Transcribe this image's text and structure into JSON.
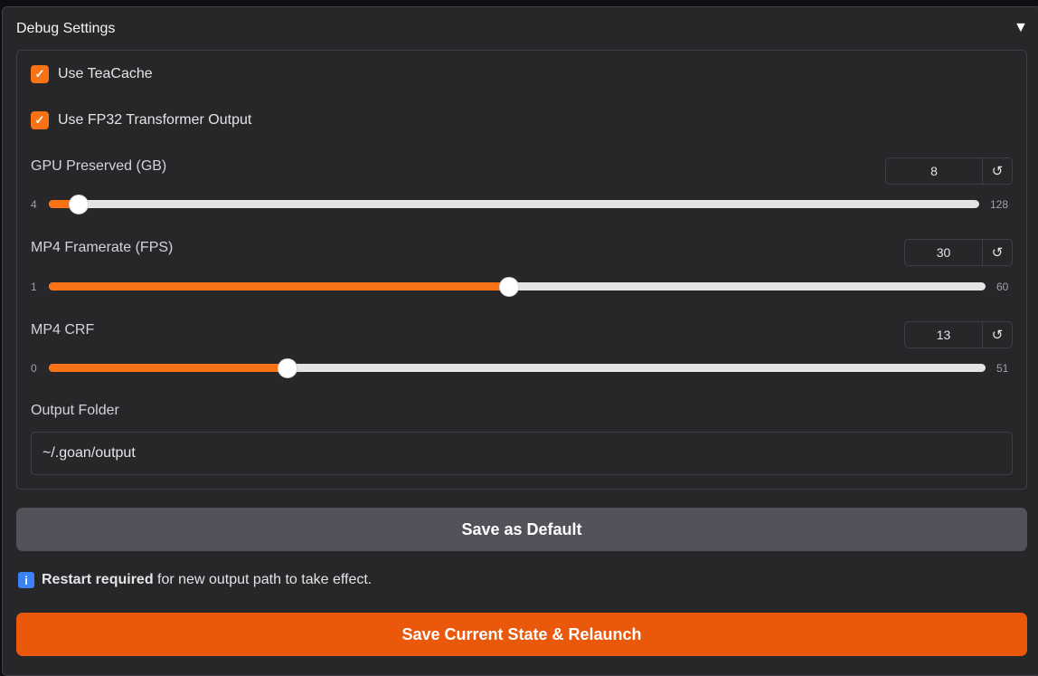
{
  "section": {
    "title": "Debug Settings",
    "collapse_icon": "triangle-down"
  },
  "checkboxes": [
    {
      "label": "Use TeaCache",
      "checked": true
    },
    {
      "label": "Use FP32 Transformer Output",
      "checked": true
    }
  ],
  "sliders": [
    {
      "label": "GPU Preserved (GB)",
      "value": "8",
      "min": "4",
      "max": "128"
    },
    {
      "label": "MP4 Framerate (FPS)",
      "value": "30",
      "min": "1",
      "max": "60"
    },
    {
      "label": "MP4 CRF",
      "value": "13",
      "min": "0",
      "max": "51"
    }
  ],
  "output_folder": {
    "label": "Output Folder",
    "value": "~/.goan/output"
  },
  "save_default_label": "Save as Default",
  "note": {
    "bold": "Restart required",
    "text": " for new output path to take effect."
  },
  "relaunch_label": "Save Current State & Relaunch",
  "colors": {
    "accent": "#f97316",
    "relaunch": "#ea580c",
    "secondary": "#52525b"
  }
}
